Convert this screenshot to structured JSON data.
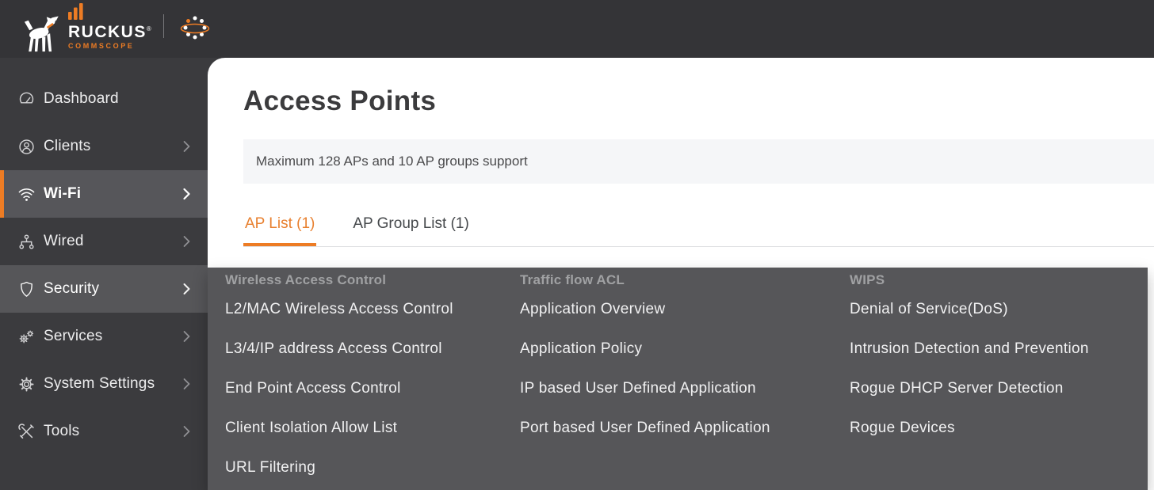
{
  "colors": {
    "accent_orange": "#ED7C24",
    "topbar_bg": "#343437",
    "sidebar_bg": "#3B3B3E",
    "highlight_bg": "#56565A",
    "flyout_bg": "#565659",
    "content_bg": "#FFFFFF",
    "notice_bg": "#F5F6F8"
  },
  "topbar": {
    "brand": "RUCKUS",
    "registered_mark": "®",
    "brand_sub": "COMMSCOPE"
  },
  "sidebar": {
    "items": [
      {
        "label": "Dashboard",
        "icon": "dashboard-gauge",
        "has_submenu": false,
        "state": "normal"
      },
      {
        "label": "Clients",
        "icon": "clients-person",
        "has_submenu": true,
        "state": "normal"
      },
      {
        "label": "Wi-Fi",
        "icon": "wifi-waves",
        "has_submenu": true,
        "state": "active"
      },
      {
        "label": "Wired",
        "icon": "wired-network",
        "has_submenu": true,
        "state": "normal"
      },
      {
        "label": "Security",
        "icon": "security-shield",
        "has_submenu": true,
        "state": "hovered"
      },
      {
        "label": "Services",
        "icon": "services-gears",
        "has_submenu": true,
        "state": "normal"
      },
      {
        "label": "System Settings",
        "icon": "settings-gear",
        "has_submenu": true,
        "state": "normal"
      },
      {
        "label": "Tools",
        "icon": "tools-cross",
        "has_submenu": true,
        "state": "normal"
      }
    ]
  },
  "main": {
    "title": "Access Points",
    "notice": "Maximum 128 APs and 10 AP groups support",
    "tabs": [
      {
        "label": "AP List (1)",
        "active": true
      },
      {
        "label": "AP Group List (1)",
        "active": false
      }
    ]
  },
  "flyout": {
    "columns": [
      {
        "header": "Wireless Access Control",
        "items": [
          "L2/MAC Wireless Access Control",
          "L3/4/IP address Access Control",
          "End Point Access Control",
          "Client Isolation Allow List",
          "URL Filtering"
        ]
      },
      {
        "header": "Traffic flow ACL",
        "items": [
          "Application Overview",
          "Application Policy",
          "IP based User Defined Application",
          "Port based User Defined Application"
        ]
      },
      {
        "header": "WIPS",
        "items": [
          "Denial of Service(DoS)",
          "Intrusion Detection and Prevention",
          "Rogue DHCP Server Detection",
          "Rogue Devices"
        ]
      }
    ]
  }
}
